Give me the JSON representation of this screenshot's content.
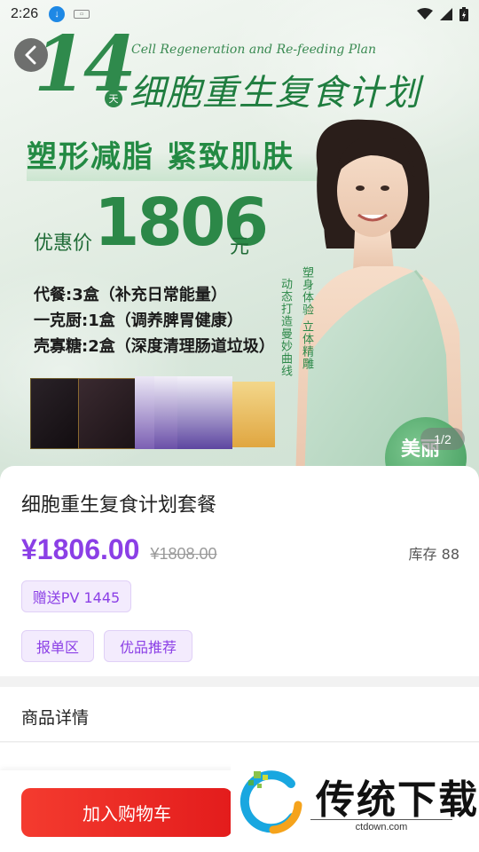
{
  "status_bar": {
    "time": "2:26"
  },
  "banner": {
    "big_number": "14",
    "day_badge": "天",
    "en_title": "Cell Regeneration and Re-feeding Plan",
    "cn_title": "细胞重生复食计划",
    "slogan": "塑形减脂 紧致肌肤",
    "price_label": "优惠价",
    "price_value": "1806",
    "price_unit": "元",
    "combo_lines": [
      "代餐:3盒（补充日常能量）",
      "一克厨:1盒（调养脾胃健康）",
      "壳寡糖:2盒（深度清理肠道垃圾）"
    ],
    "vertical_text_1": "塑身体验 立体精雕",
    "vertical_text_2": "动态打造曼妙曲线",
    "round_badge": "美丽",
    "page_indicator": "1/2"
  },
  "product": {
    "title": "细胞重生复食计划套餐",
    "price": "¥1806.00",
    "original_price": "¥1808.00",
    "stock": "库存 88",
    "gift_tag": "赠送PV 1445",
    "category_tags": [
      "报单区",
      "优品推荐"
    ]
  },
  "detail_section": {
    "title": "商品详情"
  },
  "bottom_bar": {
    "add_to_cart": "加入购物车"
  },
  "watermark": {
    "text": "传统下载",
    "url": "ctdown.com"
  },
  "colors": {
    "accent": "#8b3fe6",
    "cart_button": "#ee2a24",
    "brand_green": "#2f8a4c"
  }
}
